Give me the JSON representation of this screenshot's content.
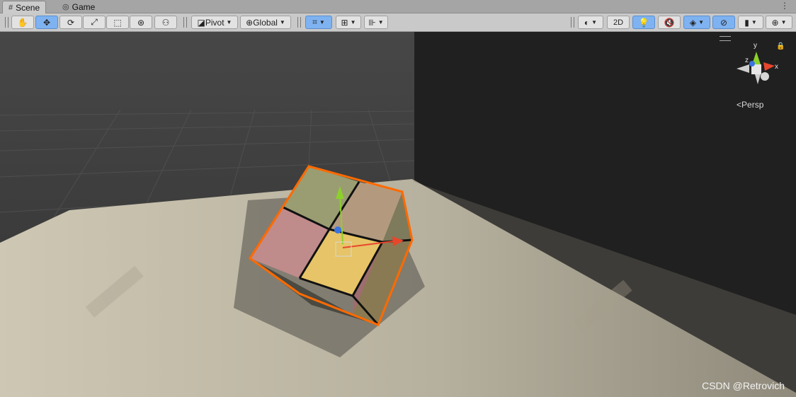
{
  "tabs": [
    {
      "label": "Scene",
      "icon": "grid-icon",
      "active": true
    },
    {
      "label": "Game",
      "icon": "gamepad-icon",
      "active": false
    }
  ],
  "toolbar": {
    "tools": [
      "hand-tool",
      "move-tool",
      "rotate-tool",
      "scale-tool",
      "rect-tool",
      "transform-tool",
      "custom-editor-tool"
    ],
    "active_tool": "move-tool",
    "pivot_label": "Pivot",
    "space_label": "Global",
    "twod_label": "2D"
  },
  "viewport": {
    "projection_label": "Persp",
    "axis_labels": {
      "x": "x",
      "y": "y",
      "z": "z"
    }
  },
  "credit": "CSDN @Retrovich",
  "colors": {
    "selection_outline": "#ff6a00",
    "axis_x": "#e8462c",
    "axis_y": "#8bd12a",
    "axis_z": "#3a74e0",
    "toolbar_active": "#7fb2f0"
  }
}
